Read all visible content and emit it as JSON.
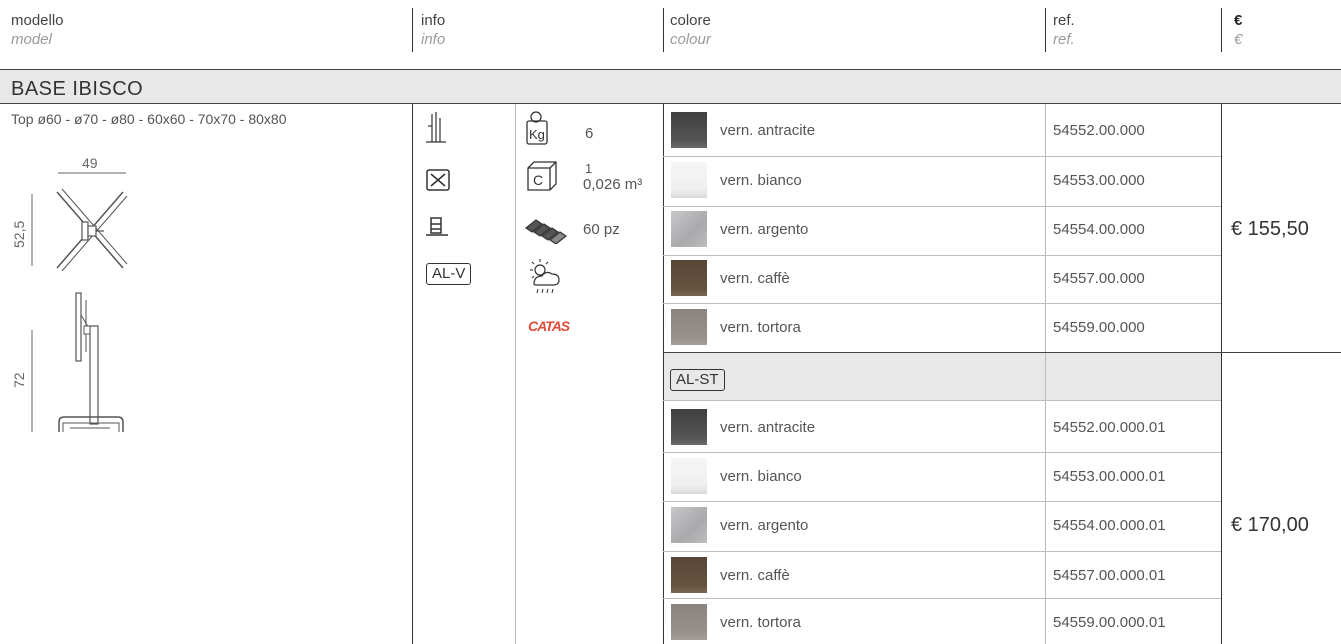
{
  "header": {
    "col1": {
      "main": "modello",
      "sub": "model"
    },
    "col2": {
      "main": "info",
      "sub": "info"
    },
    "col3": {
      "main": "colore",
      "sub": "colour"
    },
    "col4": {
      "main": "ref.",
      "sub": "ref."
    },
    "col5": {
      "main": "€",
      "sub": "€"
    }
  },
  "section": {
    "title": "BASE IBISCO"
  },
  "model": {
    "top_sizes": "Top  ø60 - ø70 - ø80 - 60x60 - 70x70 - 80x80",
    "dims": {
      "width": "49",
      "height_folded": "52,5",
      "height": "72"
    }
  },
  "info": {
    "weight": "6",
    "weight_unit": "Kg",
    "box_count": "1",
    "box_volume": "0,026 m³",
    "box_letter": "C",
    "pallet": "60 pz",
    "finish_tag": "AL-V",
    "certification": "CATAS"
  },
  "group1": {
    "price": "€ 155,50",
    "rows": [
      {
        "name": "vern. antracite",
        "ref": "54552.00.000",
        "swatch": "#4a4a4a"
      },
      {
        "name": "vern. bianco",
        "ref": "54553.00.000",
        "swatch": "#f2f2f2"
      },
      {
        "name": "vern. argento",
        "ref": "54554.00.000",
        "swatch": "#b8b8ba"
      },
      {
        "name": "vern. caffè",
        "ref": "54557.00.000",
        "swatch": "#5e4a3a"
      },
      {
        "name": "vern. tortora",
        "ref": "54559.00.000",
        "swatch": "#8f8a85"
      }
    ]
  },
  "group2": {
    "tag": "AL-ST",
    "price": "€ 170,00",
    "rows": [
      {
        "name": "vern. antracite",
        "ref": "54552.00.000.01",
        "swatch": "#4a4a4a"
      },
      {
        "name": "vern. bianco",
        "ref": "54553.00.000.01",
        "swatch": "#f2f2f2"
      },
      {
        "name": "vern. argento",
        "ref": "54554.00.000.01",
        "swatch": "#b8b8ba"
      },
      {
        "name": "vern. caffè",
        "ref": "54557.00.000.01",
        "swatch": "#5e4a3a"
      },
      {
        "name": "vern. tortora",
        "ref": "54559.00.000.01",
        "swatch": "#8f8a85"
      }
    ]
  }
}
